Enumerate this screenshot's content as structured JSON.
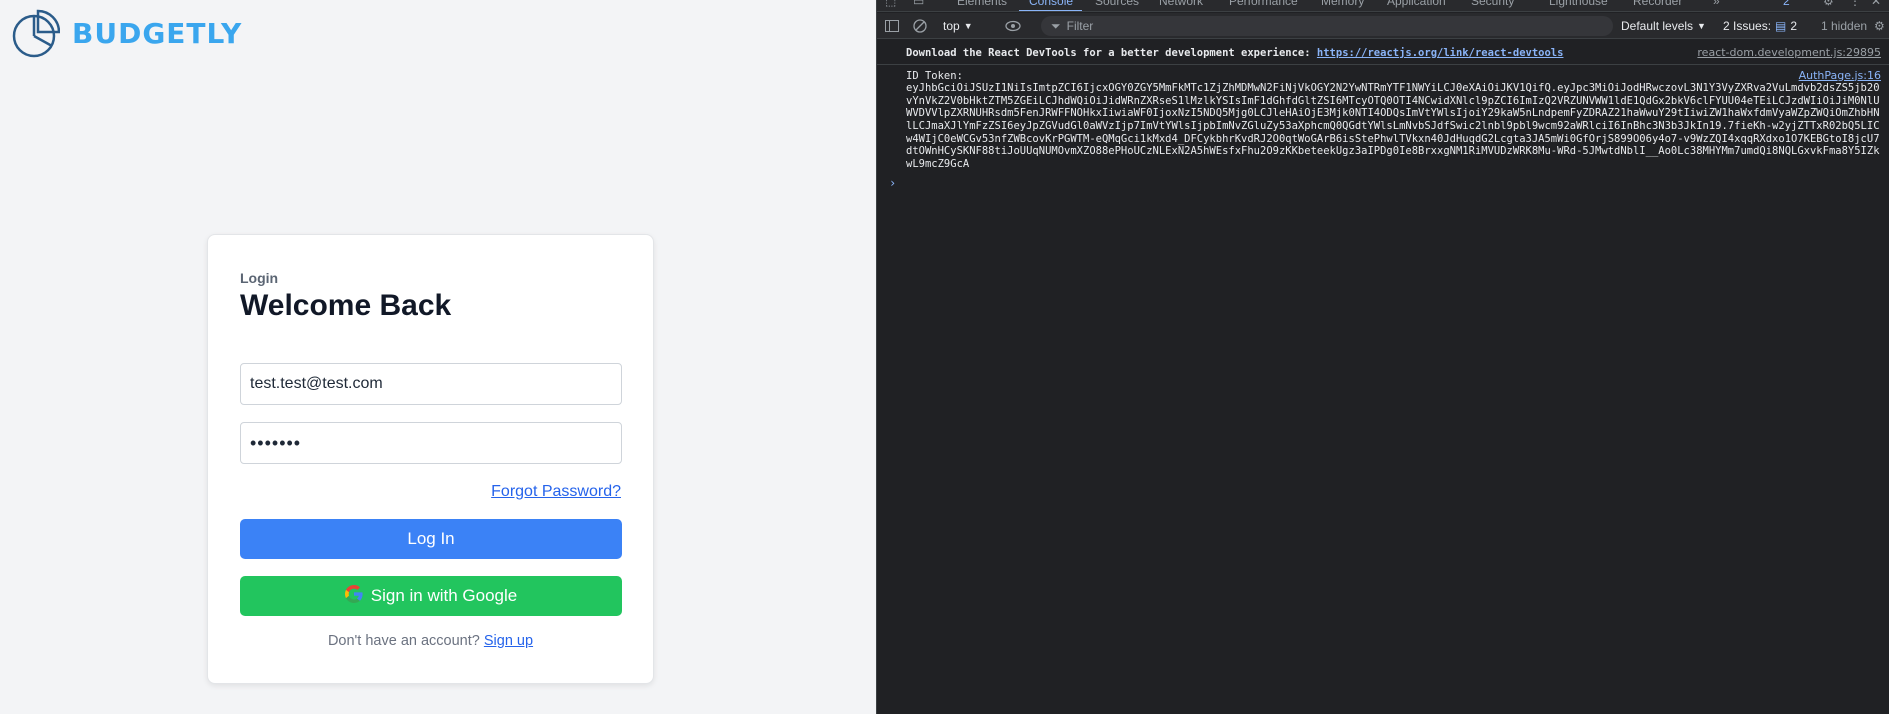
{
  "app": {
    "brand_name": "BUDGETLY",
    "brand_color": "#3aa6ee",
    "login_card": {
      "eyebrow": "Login",
      "title": "Welcome Back",
      "email_value": "test.test@test.com",
      "password_value": "•••••••",
      "forgot_password": "Forgot Password?",
      "login_button": "Log In",
      "google_button": "Sign in with Google",
      "signup_prompt": "Don't have an account?",
      "signup_link": "Sign up"
    },
    "colors": {
      "login_button": "#3b82f6",
      "google_button": "#22c55e",
      "link": "#2563eb"
    }
  },
  "devtools": {
    "tabs": [
      "Elements",
      "Console",
      "Sources",
      "Network",
      "Performance",
      "Memory",
      "Application",
      "Security",
      "Lighthouse",
      "Recorder",
      "»"
    ],
    "active_tab": "Console",
    "issues_badge": "2",
    "toolbar": {
      "context": "top",
      "filter_placeholder": "Filter",
      "levels": "Default levels",
      "issues": "2 Issues:",
      "issues_count": "2",
      "hidden": "1 hidden"
    },
    "messages": [
      {
        "text": "Download the React DevTools for a better development experience: ",
        "link": "https://reactjs.org/link/react-devtools",
        "source": "react-dom.development.js:29895"
      },
      {
        "label": "ID Token:",
        "source": "AuthPage.js:16",
        "token": "eyJhbGciOiJSUzI1NiIsImtpZCI6IjcxOGY0ZGY5MmFkMTc1ZjZhMDMwN2FiNjVkOGY2N2YwNTRmYTF1NWYiLCJ0eXAiOiJKV1QifQ.eyJpc3MiOiJodHRwczovL3N1Y3VyZXRva2VuLmdvb2dsZS5jb20vYnVkZ2V0bHktZTM5ZGEiLCJhdWQiOiJidWRnZXRseS1lMzlkYSIsImF1dGhfdGltZSI6MTcyOTQ0OTI4NCwidXNlcl9pZCI6ImIzQ2VRZUNVWW1ldE1QdGx2bkV6clFYUU04eTEiLCJzdWIiOiJiM0NlUWVDVVlpZXRNUHRsdm5FenJRWFFNOHkxIiwiaWF0IjoxNzI5NDQ5Mjg0LCJleHAiOjE3Mjk0NTI4ODQsImVtYWlsIjoiY29kaW5nLndpemFyZDRAZ21haWwuY29tIiwiZW1haWxfdmVyaWZpZWQiOmZhbHNlLCJmaXJlYmFzZSI6eyJpZGVudGl0aWVzIjp7ImVtYWlsIjpbImNvZGluZy53aXphcmQ0QGdtYWlsLmNvbSJdfSwic2lnbl9pbl9wcm92aWRlciI6InBhc3N3b3JkIn19.7fieKh-w2yjZTTxR02bQ5LICw4WIjC0eWCGv53nfZWBcovKrPGWTM-eQMqGci1kMxd4_DFCykbhrKvdRJ2O0qtWoGArB6isStePhwlTVkxn40JdHuqdG2Lcgta3JA5mWi0GfOrjS899O06y4o7-v9WzZQI4xqqRXdxo1O7KEBGtoI8jcU7dtOWnHCySKNF88tiJoUUqNUMOvmXZO88ePHoUCzNLExN2A5hWEsfxFhu2O9zKKbeteekUgz3aIPDg0Ie8BrxxgNM1RiMVUDzWRK8Mu-WRd-5JMwtdNblI__Ao0Lc38MHYMm7umdQi8NQLGxvkFma8Y5IZkwL9mcZ9GcA"
      }
    ]
  }
}
